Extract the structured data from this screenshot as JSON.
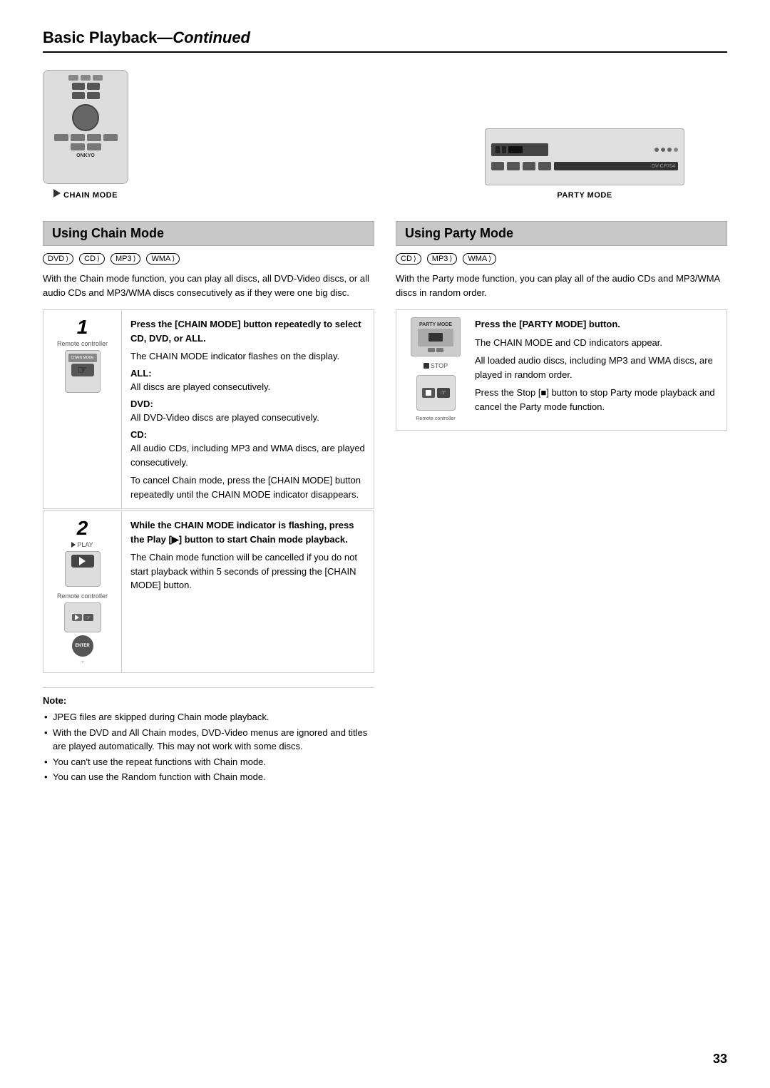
{
  "page": {
    "title_bold": "Basic Playback",
    "title_italic": "—Continued",
    "page_number": "33"
  },
  "left_image": {
    "label": "CHAIN MODE"
  },
  "right_image": {
    "label": "PARTY MODE"
  },
  "chain_mode": {
    "section_title": "Using Chain Mode",
    "badges": [
      "DVD",
      "CD",
      "MP3",
      "WMA"
    ],
    "description": "With the Chain mode function, you can play all discs, all DVD-Video discs, or all audio CDs and MP3/WMA discs consecutively as if they were one big disc.",
    "step1": {
      "number": "1",
      "label": "Remote controller",
      "title": "Press the [CHAIN MODE] button repeatedly to select CD, DVD, or ALL.",
      "body_intro": "The CHAIN MODE indicator flashes on the display.",
      "all_label": "ALL:",
      "all_text": "All discs are played consecutively.",
      "dvd_label": "DVD:",
      "dvd_text": "All DVD-Video discs are played consecutively.",
      "cd_label": "CD:",
      "cd_text": "All audio CDs, including MP3 and WMA discs, are played consecutively.",
      "cancel_text": "To cancel Chain mode, press the [CHAIN MODE] button repeatedly until the CHAIN MODE indicator disappears."
    },
    "step2": {
      "number": "2",
      "label": "Remote controller",
      "title": "While the CHAIN MODE indicator is flashing, press the Play [▶] button to start Chain mode playback.",
      "body_text": "The Chain mode function will be cancelled if you do not start playback within 5 seconds of pressing the [CHAIN MODE] button."
    }
  },
  "party_mode": {
    "section_title": "Using Party Mode",
    "badges": [
      "CD",
      "MP3",
      "WMA"
    ],
    "description": "With the Party mode function, you can play all of the audio CDs and MP3/WMA discs in random order.",
    "step1": {
      "label_device": "PARTY MODE",
      "label_remote": "Remote controller",
      "title": "Press the [PARTY MODE] button.",
      "body1": "The CHAIN MODE and CD indicators appear.",
      "body2": "All loaded audio discs, including MP3 and WMA discs, are played in random order.",
      "body3": "Press the Stop [■] button to stop Party mode playback and cancel the Party mode function."
    }
  },
  "notes": {
    "title": "Note:",
    "items": [
      "JPEG files are skipped during Chain mode playback.",
      "With the DVD and All Chain modes, DVD-Video menus are ignored and titles are played automatically. This may not work with some discs.",
      "You can't use the repeat functions with Chain mode.",
      "You can use the Random function with Chain mode."
    ]
  }
}
